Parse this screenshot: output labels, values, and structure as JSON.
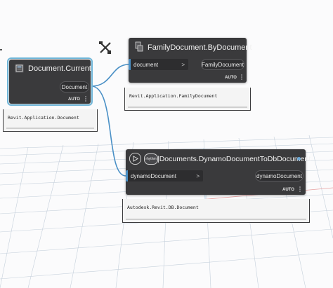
{
  "nodes": {
    "document_current": {
      "title": "Document.Current",
      "output_port": "Document",
      "lacing": "AUTO",
      "preview": "Revit.Application.Document"
    },
    "family_document": {
      "title": "FamilyDocument.ByDocument",
      "input_port": "document",
      "input_arrow": ">",
      "output_port": "FamilyDocument",
      "lacing": "AUTO",
      "preview": "Revit.Application.FamilyDocument"
    },
    "dynamo_to_db": {
      "title": "|Documents.DynamoDocumentToDbDocument",
      "badge": "rhythm",
      "input_port": "dynamoDocument",
      "input_arrow": ">",
      "output_port": "dynamoDocument",
      "lacing": "AUTO",
      "preview": "Autodesk.Revit.DB.Document"
    }
  },
  "icons": {
    "document_current": "document-icon",
    "family_document": "family-document-icon",
    "floating_tool": "wrench-icon",
    "dynamo_to_db": "rhythm-package-icon"
  },
  "colors": {
    "node_body": "#3a3a3c",
    "selection": "#6fb6d9",
    "wire": "#4a90c6",
    "grid": "#b9c6d3"
  }
}
